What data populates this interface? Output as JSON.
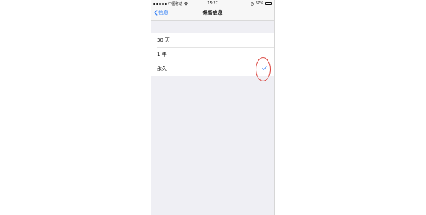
{
  "status_bar": {
    "carrier": "中国移动",
    "time": "15:27",
    "battery_percent": "57%",
    "battery_level": 0.57
  },
  "nav": {
    "back_label": "信息",
    "title": "保留信息"
  },
  "options": [
    {
      "label": "30 天",
      "selected": false
    },
    {
      "label": "1 年",
      "selected": false
    },
    {
      "label": "永久",
      "selected": true
    }
  ],
  "colors": {
    "accent": "#2d7cf6",
    "annotation": "#d9403a",
    "background": "#efeff4"
  },
  "icons": {
    "back": "chevron-left-icon",
    "check": "checkmark-icon",
    "wifi": "wifi-icon",
    "alarm": "alarm-icon",
    "battery": "battery-icon"
  }
}
